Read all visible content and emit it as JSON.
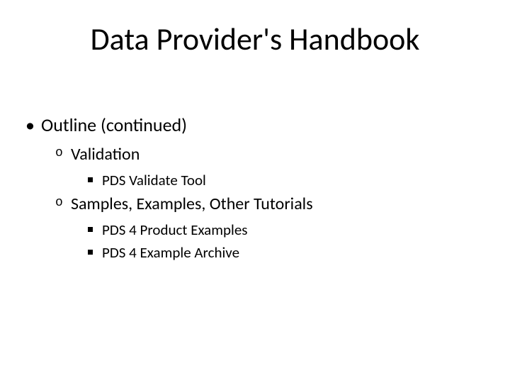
{
  "title": "Data Provider's Handbook",
  "outline": {
    "heading": "Outline (continued)",
    "sections": [
      {
        "label": "Validation",
        "items": [
          {
            "label": "PDS Validate Tool"
          }
        ]
      },
      {
        "label": "Samples, Examples, Other Tutorials",
        "items": [
          {
            "label": "PDS 4 Product Examples"
          },
          {
            "label": "PDS 4 Example Archive"
          }
        ]
      }
    ]
  }
}
